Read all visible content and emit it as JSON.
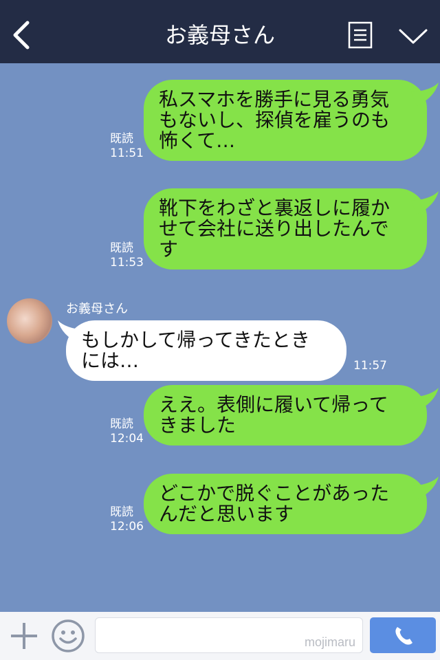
{
  "header": {
    "title": "お義母さん"
  },
  "messages": [
    {
      "side": "me",
      "text": "私スマホを勝手に見る勇気\nもないし、探偵を雇うのも\n怖くて…",
      "read": "既読",
      "time": "11:51"
    },
    {
      "side": "me",
      "text": "靴下をわざと裏返しに履か\nせて会社に送り出したんで\nす",
      "read": "既読",
      "time": "11:53"
    },
    {
      "side": "them",
      "sender": "お義母さん",
      "text": "もしかして帰ってきたとき\nには…",
      "time": "11:57"
    },
    {
      "side": "me",
      "text": "ええ。表側に履いて帰って\nきました",
      "read": "既読",
      "time": "12:04"
    },
    {
      "side": "me",
      "text": "どこかで脱ぐことがあった\nんだと思います",
      "read": "既読",
      "time": "12:06"
    }
  ],
  "footer": {
    "input_value": "",
    "watermark": "mojimaru"
  },
  "icons": {
    "back": "chevron-left-icon",
    "menu": "note-icon",
    "collapse": "chevron-down-icon",
    "add": "plus-icon",
    "emoji": "smiley-icon",
    "call": "phone-icon"
  },
  "colors": {
    "header_bg": "#232c45",
    "chat_bg": "#7391c2",
    "my_bubble": "#85e249",
    "their_bubble": "#ffffff",
    "call_button": "#5b8ee2"
  }
}
